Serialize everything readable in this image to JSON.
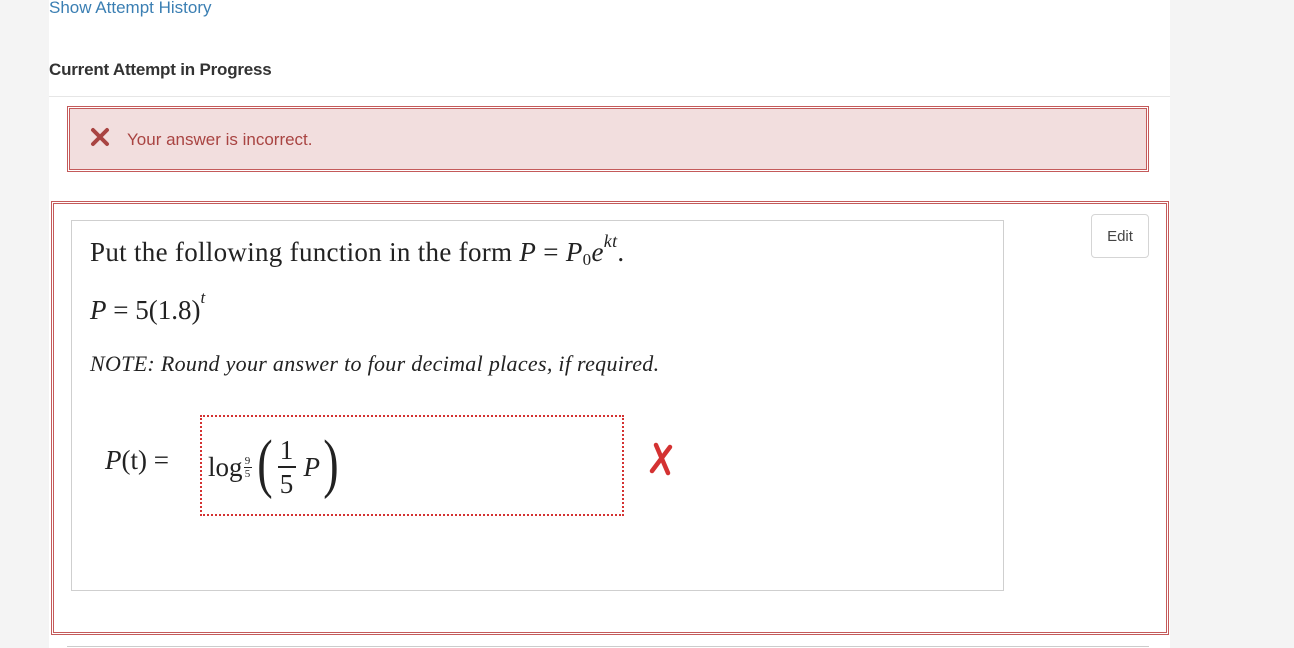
{
  "header": {
    "attempt_history_link": "Show Attempt History",
    "section_title": "Current Attempt in Progress"
  },
  "feedback": {
    "icon": "x-icon",
    "message": "Your answer is incorrect.",
    "color": "#a94442",
    "background": "#f2dede"
  },
  "question": {
    "edit_label": "Edit",
    "instruction_text": "Put the following function in the form",
    "instruction_math": {
      "lhs": "P",
      "equals": "=",
      "base": "P",
      "base_subscript": "0",
      "exp_base": "e",
      "exponent": "kt",
      "period": "."
    },
    "given": {
      "lhs": "P",
      "equals": "=",
      "rhs": "5(1.8)",
      "exponent": "t"
    },
    "note": "NOTE: Round your answer to four decimal places, if required.",
    "answer": {
      "label_fn": "P",
      "label_arg": "(t)",
      "equals": "=",
      "value": {
        "log": "log",
        "base_num": "9",
        "base_den": "5",
        "paren_open": "(",
        "frac_num": "1",
        "frac_den": "5",
        "var": "P",
        "paren_close": ")"
      },
      "status_icon": "cross-icon",
      "status_color": "#d43232"
    }
  }
}
